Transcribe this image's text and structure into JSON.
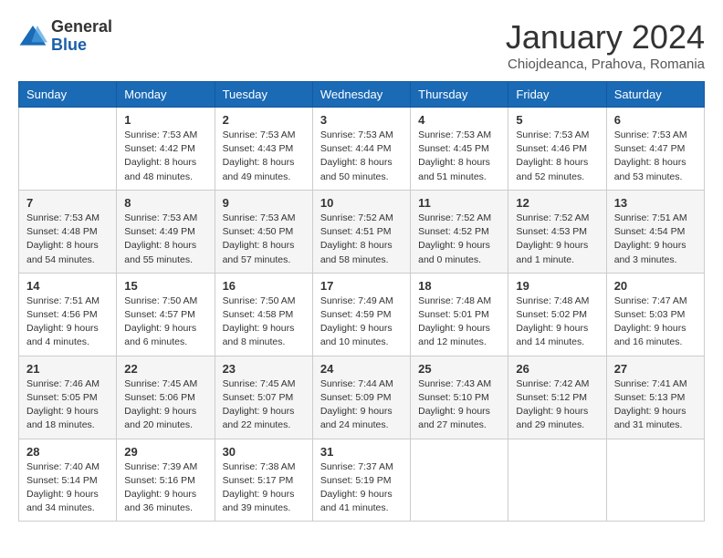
{
  "logo": {
    "general": "General",
    "blue": "Blue"
  },
  "title": "January 2024",
  "subtitle": "Chiojdeanca, Prahova, Romania",
  "weekdays": [
    "Sunday",
    "Monday",
    "Tuesday",
    "Wednesday",
    "Thursday",
    "Friday",
    "Saturday"
  ],
  "weeks": [
    [
      {
        "day": "",
        "info": ""
      },
      {
        "day": "1",
        "info": "Sunrise: 7:53 AM\nSunset: 4:42 PM\nDaylight: 8 hours\nand 48 minutes."
      },
      {
        "day": "2",
        "info": "Sunrise: 7:53 AM\nSunset: 4:43 PM\nDaylight: 8 hours\nand 49 minutes."
      },
      {
        "day": "3",
        "info": "Sunrise: 7:53 AM\nSunset: 4:44 PM\nDaylight: 8 hours\nand 50 minutes."
      },
      {
        "day": "4",
        "info": "Sunrise: 7:53 AM\nSunset: 4:45 PM\nDaylight: 8 hours\nand 51 minutes."
      },
      {
        "day": "5",
        "info": "Sunrise: 7:53 AM\nSunset: 4:46 PM\nDaylight: 8 hours\nand 52 minutes."
      },
      {
        "day": "6",
        "info": "Sunrise: 7:53 AM\nSunset: 4:47 PM\nDaylight: 8 hours\nand 53 minutes."
      }
    ],
    [
      {
        "day": "7",
        "info": "Sunrise: 7:53 AM\nSunset: 4:48 PM\nDaylight: 8 hours\nand 54 minutes."
      },
      {
        "day": "8",
        "info": "Sunrise: 7:53 AM\nSunset: 4:49 PM\nDaylight: 8 hours\nand 55 minutes."
      },
      {
        "day": "9",
        "info": "Sunrise: 7:53 AM\nSunset: 4:50 PM\nDaylight: 8 hours\nand 57 minutes."
      },
      {
        "day": "10",
        "info": "Sunrise: 7:52 AM\nSunset: 4:51 PM\nDaylight: 8 hours\nand 58 minutes."
      },
      {
        "day": "11",
        "info": "Sunrise: 7:52 AM\nSunset: 4:52 PM\nDaylight: 9 hours\nand 0 minutes."
      },
      {
        "day": "12",
        "info": "Sunrise: 7:52 AM\nSunset: 4:53 PM\nDaylight: 9 hours\nand 1 minute."
      },
      {
        "day": "13",
        "info": "Sunrise: 7:51 AM\nSunset: 4:54 PM\nDaylight: 9 hours\nand 3 minutes."
      }
    ],
    [
      {
        "day": "14",
        "info": "Sunrise: 7:51 AM\nSunset: 4:56 PM\nDaylight: 9 hours\nand 4 minutes."
      },
      {
        "day": "15",
        "info": "Sunrise: 7:50 AM\nSunset: 4:57 PM\nDaylight: 9 hours\nand 6 minutes."
      },
      {
        "day": "16",
        "info": "Sunrise: 7:50 AM\nSunset: 4:58 PM\nDaylight: 9 hours\nand 8 minutes."
      },
      {
        "day": "17",
        "info": "Sunrise: 7:49 AM\nSunset: 4:59 PM\nDaylight: 9 hours\nand 10 minutes."
      },
      {
        "day": "18",
        "info": "Sunrise: 7:48 AM\nSunset: 5:01 PM\nDaylight: 9 hours\nand 12 minutes."
      },
      {
        "day": "19",
        "info": "Sunrise: 7:48 AM\nSunset: 5:02 PM\nDaylight: 9 hours\nand 14 minutes."
      },
      {
        "day": "20",
        "info": "Sunrise: 7:47 AM\nSunset: 5:03 PM\nDaylight: 9 hours\nand 16 minutes."
      }
    ],
    [
      {
        "day": "21",
        "info": "Sunrise: 7:46 AM\nSunset: 5:05 PM\nDaylight: 9 hours\nand 18 minutes."
      },
      {
        "day": "22",
        "info": "Sunrise: 7:45 AM\nSunset: 5:06 PM\nDaylight: 9 hours\nand 20 minutes."
      },
      {
        "day": "23",
        "info": "Sunrise: 7:45 AM\nSunset: 5:07 PM\nDaylight: 9 hours\nand 22 minutes."
      },
      {
        "day": "24",
        "info": "Sunrise: 7:44 AM\nSunset: 5:09 PM\nDaylight: 9 hours\nand 24 minutes."
      },
      {
        "day": "25",
        "info": "Sunrise: 7:43 AM\nSunset: 5:10 PM\nDaylight: 9 hours\nand 27 minutes."
      },
      {
        "day": "26",
        "info": "Sunrise: 7:42 AM\nSunset: 5:12 PM\nDaylight: 9 hours\nand 29 minutes."
      },
      {
        "day": "27",
        "info": "Sunrise: 7:41 AM\nSunset: 5:13 PM\nDaylight: 9 hours\nand 31 minutes."
      }
    ],
    [
      {
        "day": "28",
        "info": "Sunrise: 7:40 AM\nSunset: 5:14 PM\nDaylight: 9 hours\nand 34 minutes."
      },
      {
        "day": "29",
        "info": "Sunrise: 7:39 AM\nSunset: 5:16 PM\nDaylight: 9 hours\nand 36 minutes."
      },
      {
        "day": "30",
        "info": "Sunrise: 7:38 AM\nSunset: 5:17 PM\nDaylight: 9 hours\nand 39 minutes."
      },
      {
        "day": "31",
        "info": "Sunrise: 7:37 AM\nSunset: 5:19 PM\nDaylight: 9 hours\nand 41 minutes."
      },
      {
        "day": "",
        "info": ""
      },
      {
        "day": "",
        "info": ""
      },
      {
        "day": "",
        "info": ""
      }
    ]
  ]
}
